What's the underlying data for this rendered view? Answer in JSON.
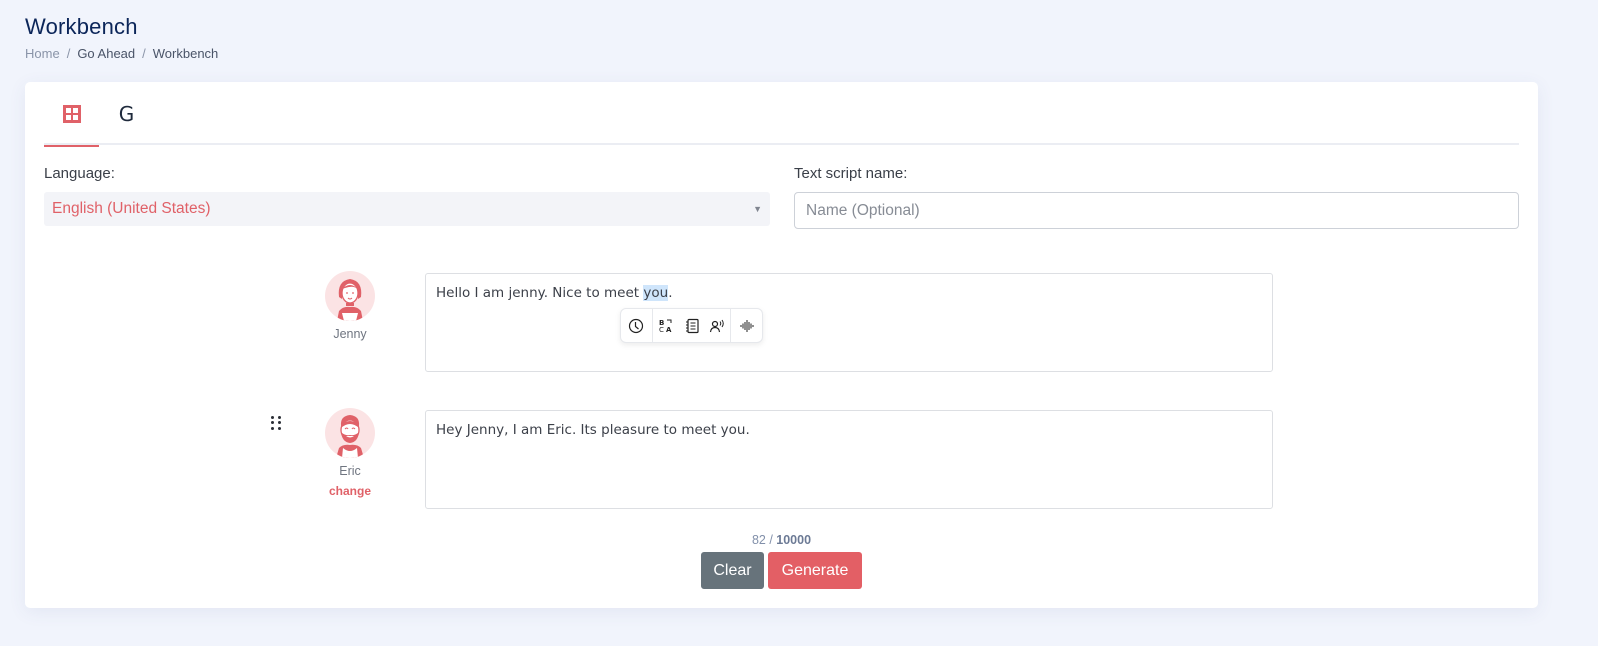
{
  "header": {
    "title": "Workbench",
    "breadcrumb": [
      "Home",
      "Go Ahead",
      "Workbench"
    ],
    "separator": "/"
  },
  "tabs": [
    {
      "icon": "grid-icon",
      "label": "",
      "active": true
    },
    {
      "icon": "g-letter-icon",
      "label": "G",
      "active": false
    }
  ],
  "form": {
    "language_label": "Language:",
    "language_value": "English (United States)",
    "script_name_label": "Text script name:",
    "script_name_placeholder": "Name (Optional)",
    "script_name_value": ""
  },
  "dialogue": [
    {
      "speaker": "Jenny",
      "avatar": "female-avatar",
      "text_before": "Hello I am jenny. Nice to meet ",
      "text_selected": "you",
      "text_after": ".",
      "show_change": false
    },
    {
      "speaker": "Eric",
      "avatar": "male-avatar",
      "text": "Hey Jenny, I am Eric. Its pleasure to meet you.",
      "show_change": true,
      "change_label": "change"
    }
  ],
  "selection_toolbar": [
    {
      "icon": "clock-pause-icon",
      "title": "Pause"
    },
    {
      "icon": "translate-icon",
      "title": "Say as"
    },
    {
      "icon": "list-document-icon",
      "title": "Phoneme"
    },
    {
      "icon": "speaker-voice-icon",
      "title": "Voice"
    },
    {
      "icon": "waveform-icon",
      "title": "Audio"
    }
  ],
  "counter": {
    "used": "82",
    "separator": " / ",
    "max": "10000"
  },
  "actions": {
    "clear_label": "Clear",
    "generate_label": "Generate"
  },
  "colors": {
    "accent": "#e06168",
    "title": "#0b2559",
    "clear_button": "#67737b",
    "generate_button": "#e35f65"
  }
}
